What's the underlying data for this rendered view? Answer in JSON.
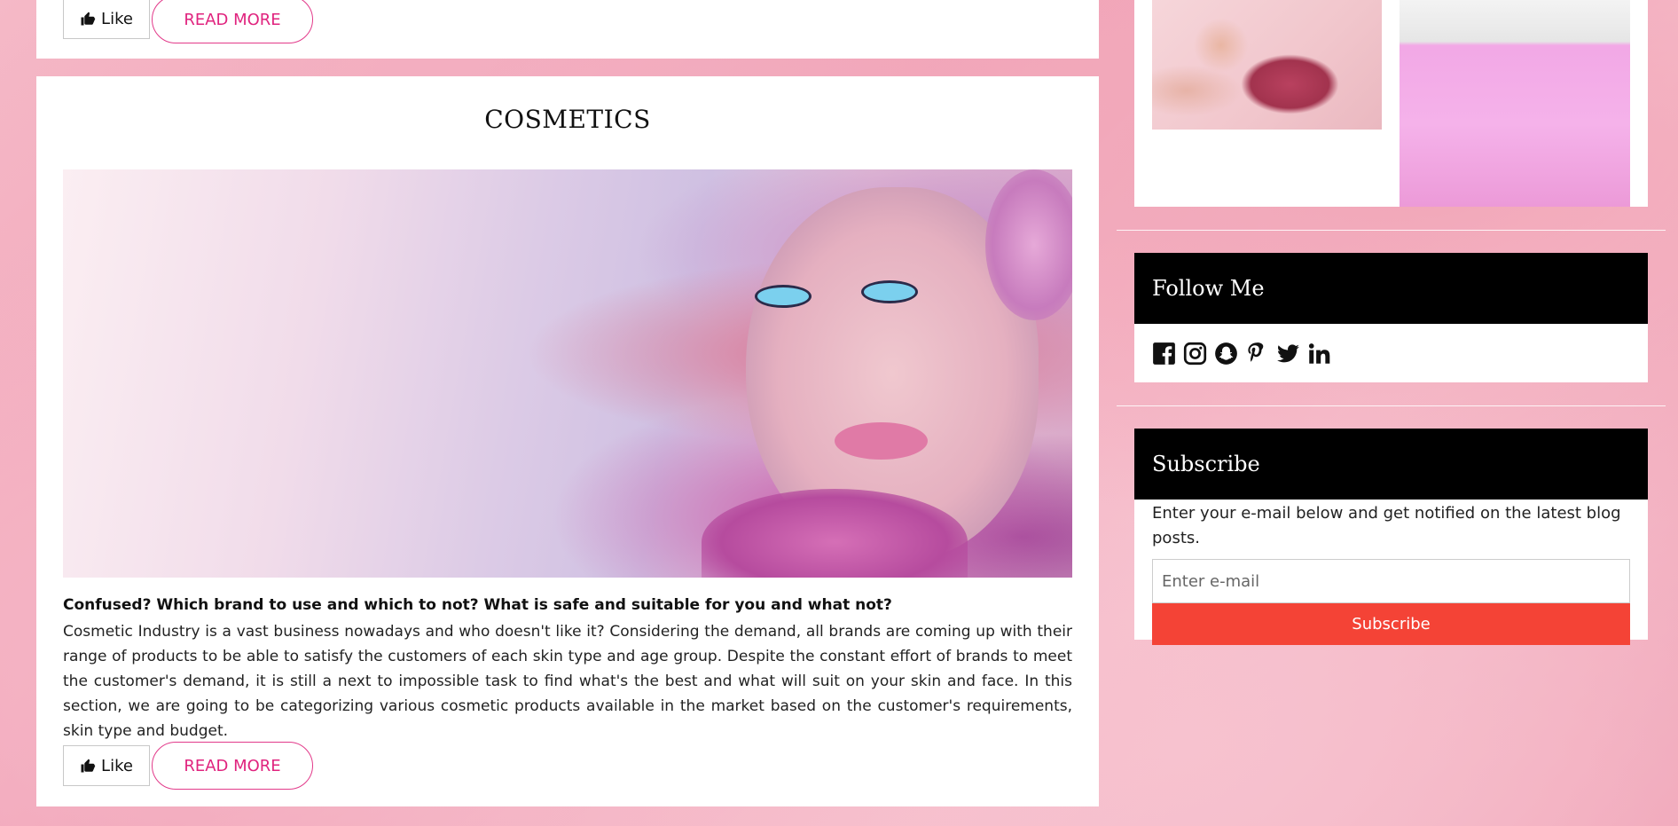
{
  "top_post": {
    "like_label": "Like",
    "read_more_label": "READ MORE"
  },
  "post": {
    "title": "COSMETICS",
    "subtitle": "Confused? Which brand to use and which to not? What is safe and suitable for you and what not?",
    "body": "Cosmetic Industry is a vast business nowadays and who doesn't like it? Considering the demand, all brands are coming up with their range of products to be able to satisfy the customers of each skin type and age group. Despite the constant effort of brands to meet the customer's demand, it is still a next to impossible task to find what's the best and what will suit on your skin and face. In this section, we are going to be categorizing various cosmetic products available in the market based on the customer's requirements, skin type and budget.",
    "like_label": "Like",
    "read_more_label": "READ MORE"
  },
  "sidebar": {
    "follow": {
      "title": "Follow Me",
      "icons": [
        "facebook-icon",
        "instagram-icon",
        "snapchat-icon",
        "pinterest-icon",
        "twitter-icon",
        "linkedin-icon"
      ]
    },
    "subscribe": {
      "title": "Subscribe",
      "description": "Enter your e-mail below and get notified on the latest blog posts.",
      "input_placeholder": "Enter e-mail",
      "button_label": "Subscribe"
    }
  },
  "colors": {
    "accent_pink": "#e0237e",
    "subscribe_red": "#f44336",
    "widget_header_bg": "#000000"
  }
}
